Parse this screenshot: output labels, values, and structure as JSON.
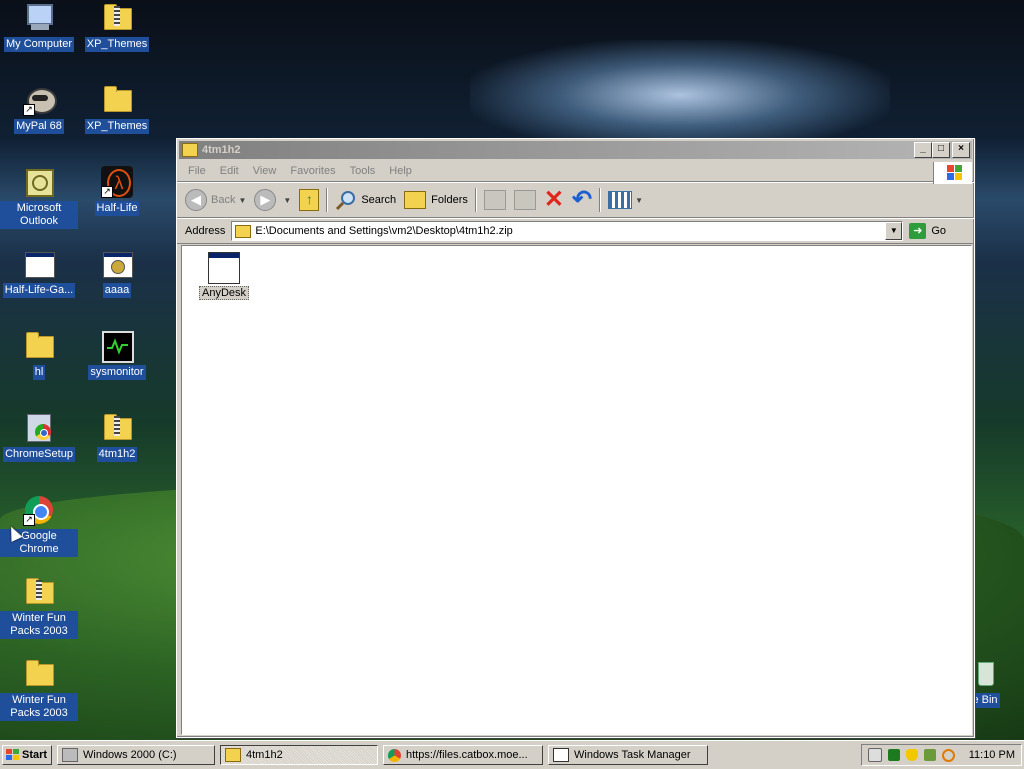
{
  "desktop": {
    "icons": [
      {
        "label": "My Computer",
        "icon": "my-computer-icon"
      },
      {
        "label": "XP_Themes",
        "icon": "zip-folder-icon"
      },
      {
        "label": "MyPal 68",
        "icon": "mypal-icon"
      },
      {
        "label": "XP_Themes",
        "icon": "folder-icon"
      },
      {
        "label": "Microsoft Outlook",
        "icon": "outlook-icon"
      },
      {
        "label": "Half-Life",
        "icon": "half-life-icon"
      },
      {
        "label": "Half-Life-Ga...",
        "icon": "app-window-icon"
      },
      {
        "label": "aaaa",
        "icon": "app-window-icon"
      },
      {
        "label": "hl",
        "icon": "folder-icon"
      },
      {
        "label": "sysmonitor",
        "icon": "sysmonitor-icon"
      },
      {
        "label": "ChromeSetup",
        "icon": "installer-icon"
      },
      {
        "label": "4tm1h2",
        "icon": "zip-folder-icon"
      },
      {
        "label": "Google Chrome",
        "icon": "chrome-icon"
      },
      {
        "label": "Winter Fun Packs 2003",
        "icon": "zip-folder-icon"
      },
      {
        "label": "Winter Fun Packs 2003",
        "icon": "folder-icon"
      },
      {
        "label": "le Bin",
        "icon": "recycle-bin-icon"
      }
    ]
  },
  "window": {
    "title": "4tm1h2",
    "controls": {
      "minimize": "_",
      "maximize": "□",
      "close": "×"
    },
    "menu": [
      "File",
      "Edit",
      "View",
      "Favorites",
      "Tools",
      "Help"
    ],
    "toolbar": {
      "back": "Back",
      "search": "Search",
      "folders": "Folders"
    },
    "address": {
      "label": "Address",
      "value": "E:\\Documents and Settings\\vm2\\Desktop\\4tm1h2.zip",
      "go": "Go"
    },
    "files": [
      {
        "name": "AnyDesk",
        "icon": "app-window-icon"
      }
    ]
  },
  "taskbar": {
    "start": "Start",
    "tasks": [
      {
        "label": "Windows 2000 (C:)",
        "icon": "drive-icon",
        "active": false
      },
      {
        "label": "4tm1h2",
        "icon": "zip-folder-icon",
        "active": true
      },
      {
        "label": "https://files.catbox.moe...",
        "icon": "chrome-icon",
        "active": false
      },
      {
        "label": "Windows Task Manager",
        "icon": "task-manager-icon",
        "active": false
      }
    ],
    "clock": "11:10 PM"
  },
  "colors": {
    "selection": "#1f4f9a",
    "titlebar_inactive": "#808080",
    "chrome_face": "#d4d0c8"
  }
}
